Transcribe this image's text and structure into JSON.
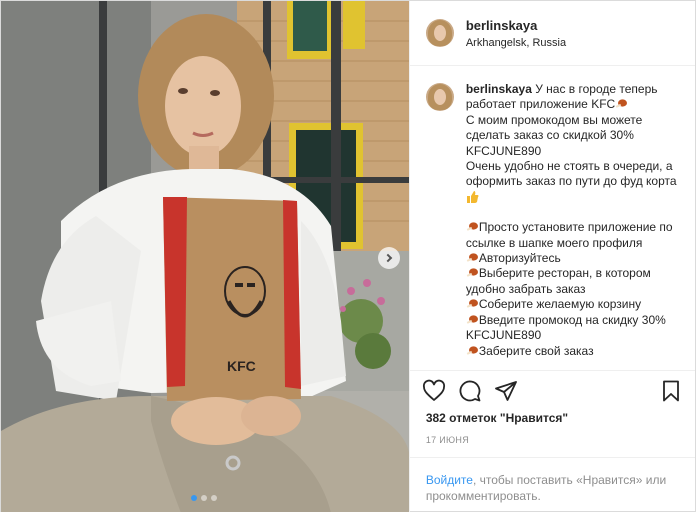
{
  "post": {
    "username": "berlinskaya",
    "location": "Arkhangelsk, Russia"
  },
  "caption": {
    "username": "berlinskaya",
    "line1": "У нас в городе теперь работает приложение KFC",
    "line2": "С моим промокодом вы можете сделать заказ со скидкой 30% KFCJUNE890",
    "line3": "Очень удобно не стоять в очереди, а оформить заказ по пути до фуд корта",
    "step1": "Просто установите приложение по ссылке в шапке моего профиля",
    "step2": "Авторизуйтесь",
    "step3": "Выберите ресторан, в котором удобно забрать заказ",
    "step4": "Соберите желаемую корзину",
    "step5": "Введите промокод на скидку 30% KFCJUNE890",
    "step6": "Заберите свой заказ"
  },
  "icons": {
    "drumstick": "drumstick-emoji",
    "thumbs_up": "thumbs-up-emoji",
    "like": "heart-icon",
    "comment": "comment-icon",
    "share": "share-icon",
    "save": "bookmark-icon",
    "next": "chevron-right-icon"
  },
  "likes_text": "382 отметок \"Нравится\"",
  "date_text": "17 ИЮНЯ",
  "login": {
    "link": "Войдите",
    "rest": ", чтобы поставить «Нравится» или прокомментировать."
  },
  "carousel": {
    "total": 3,
    "current": 1
  },
  "colors": {
    "accent": "#3897f0",
    "text": "#262626",
    "muted": "#8e8e8e",
    "kfc_red": "#c8342c"
  }
}
